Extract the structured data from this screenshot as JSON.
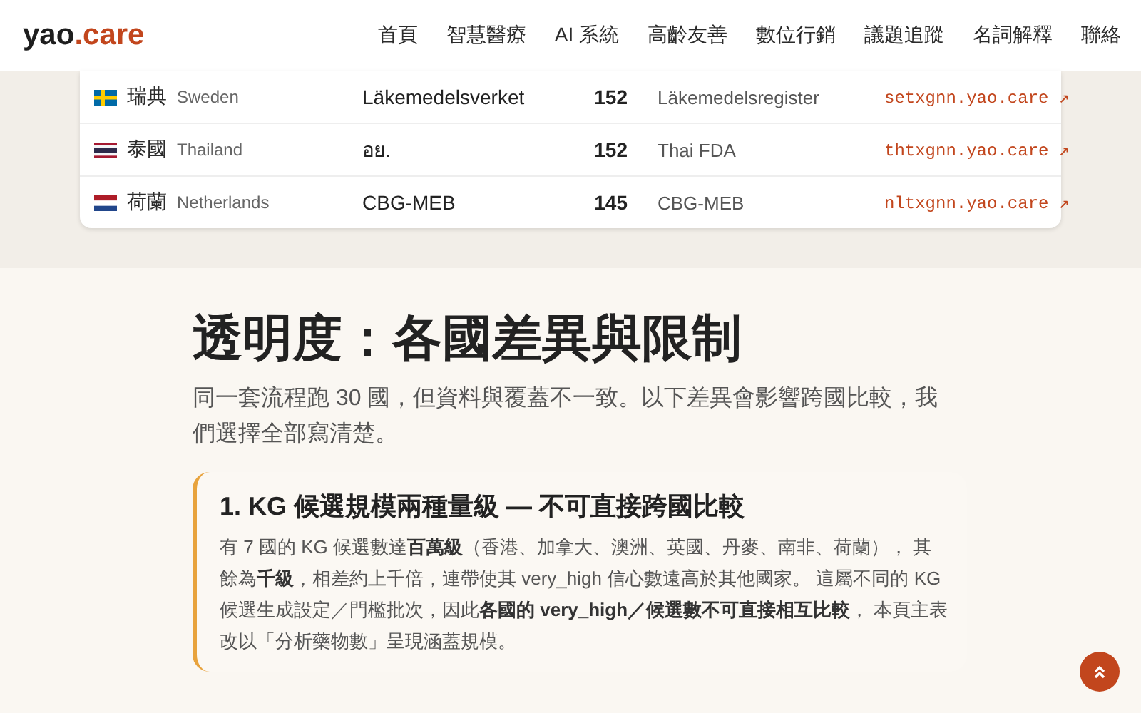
{
  "header": {
    "logo": {
      "name": "yao",
      "suffix": ".care"
    },
    "nav": [
      {
        "label": "首頁"
      },
      {
        "label": "智慧醫療"
      },
      {
        "label": "AI 系統"
      },
      {
        "label": "高齡友善"
      },
      {
        "label": "數位行銷"
      },
      {
        "label": "議題追蹤"
      },
      {
        "label": "名詞解釋"
      },
      {
        "label": "聯絡"
      }
    ]
  },
  "table": {
    "rows": [
      {
        "flag": {
          "kind": "nordic_cross"
        },
        "country": "瑞典",
        "country_en": "Sweden",
        "agency": "Läkemedelsverket",
        "count": "152",
        "registry": "Läkemedelsregister",
        "link": "setxgnn.yao.care ↗"
      },
      {
        "flag": {
          "kind": "five_stripes"
        },
        "country": "泰國",
        "country_en": "Thailand",
        "agency": "อย.",
        "count": "152",
        "registry": "Thai FDA",
        "link": "thtxgnn.yao.care ↗"
      },
      {
        "flag": {
          "kind": "three_stripes"
        },
        "country": "荷蘭",
        "country_en": "Netherlands",
        "agency": "CBG-MEB",
        "count": "145",
        "registry": "CBG-MEB",
        "link": "nltxgnn.yao.care ↗"
      }
    ]
  },
  "section": {
    "title": "透明度：各國差異與限制",
    "intro": "同一套流程跑 30 國，但資料與覆蓋不一致。以下差異會影響跨國比較，我們選擇全部寫清楚。",
    "callouts": [
      {
        "title": "1. KG 候選規模兩種量級 — 不可直接跨國比較",
        "body": "有 7 國的 KG 候選數達**百萬級**（香港、加拿大、澳洲、英國、丹麥、南非、荷蘭）， 其餘為**千級**，相差約上千倍，連帶使其 very_high 信心數遠高於其他國家。 這屬不同的 KG 候選生成設定／門檻批次，因此**各國的 very_high／候選數不可直接相互比較**， 本頁主表改以「分析藥物數」呈現涵蓋規模。"
      }
    ]
  }
}
